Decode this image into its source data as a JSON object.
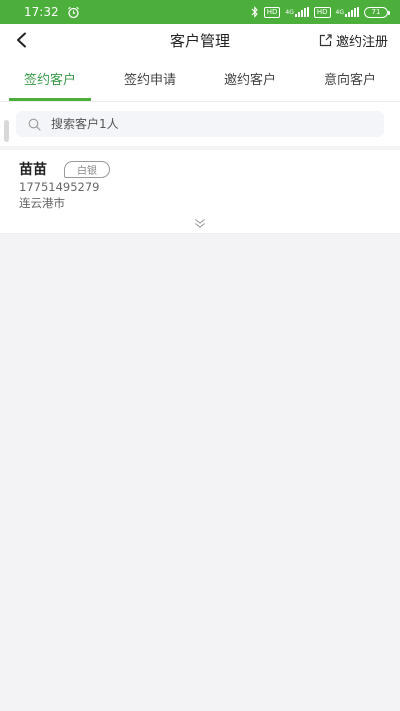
{
  "status_bar": {
    "time": "17:32",
    "alarm_icon": "alarm-icon",
    "bluetooth_icon": "bluetooth-icon",
    "hd_tag_1": "HD",
    "net_tag_1": "4G",
    "hd_tag_2": "HD",
    "net_tag_2": "4G",
    "battery_level": "71"
  },
  "header": {
    "title": "客户管理",
    "back_icon": "back-arrow-icon",
    "invite_register_label": "邀约注册",
    "invite_icon": "share-icon"
  },
  "tabs": [
    {
      "label": "签约客户",
      "active": true
    },
    {
      "label": "签约申请",
      "active": false
    },
    {
      "label": "邀约客户",
      "active": false
    },
    {
      "label": "意向客户",
      "active": false
    }
  ],
  "search": {
    "placeholder": "搜索客户1人",
    "value": "",
    "icon": "search-icon"
  },
  "customers": [
    {
      "name": "苗苗",
      "level": "白银",
      "phone": "17751495279",
      "city": "连云港市"
    }
  ],
  "colors": {
    "brand_green": "#4caf3c",
    "active_tab_text": "#3a9b4a",
    "page_background": "#f3f3f6"
  }
}
